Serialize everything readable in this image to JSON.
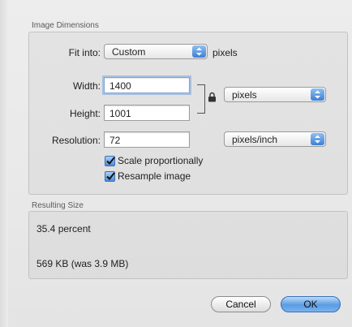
{
  "image_dimensions": {
    "section_label": "Image Dimensions",
    "fit_into": {
      "label": "Fit into:",
      "value": "Custom",
      "unit": "pixels"
    },
    "width": {
      "label": "Width:",
      "value": "1400"
    },
    "height": {
      "label": "Height:",
      "value": "1001"
    },
    "size_unit": "pixels",
    "resolution": {
      "label": "Resolution:",
      "value": "72",
      "unit": "pixels/inch"
    },
    "scale_proportionally": {
      "label": "Scale proportionally",
      "checked": true
    },
    "resample_image": {
      "label": "Resample image",
      "checked": true
    }
  },
  "resulting_size": {
    "section_label": "Resulting Size",
    "percent": "35.4 percent",
    "file_size": "569 KB (was 3.9 MB)"
  },
  "buttons": {
    "cancel": "Cancel",
    "ok": "OK"
  },
  "colors": {
    "accent": "#4b8ddb",
    "default_button": "#5b9be2"
  }
}
